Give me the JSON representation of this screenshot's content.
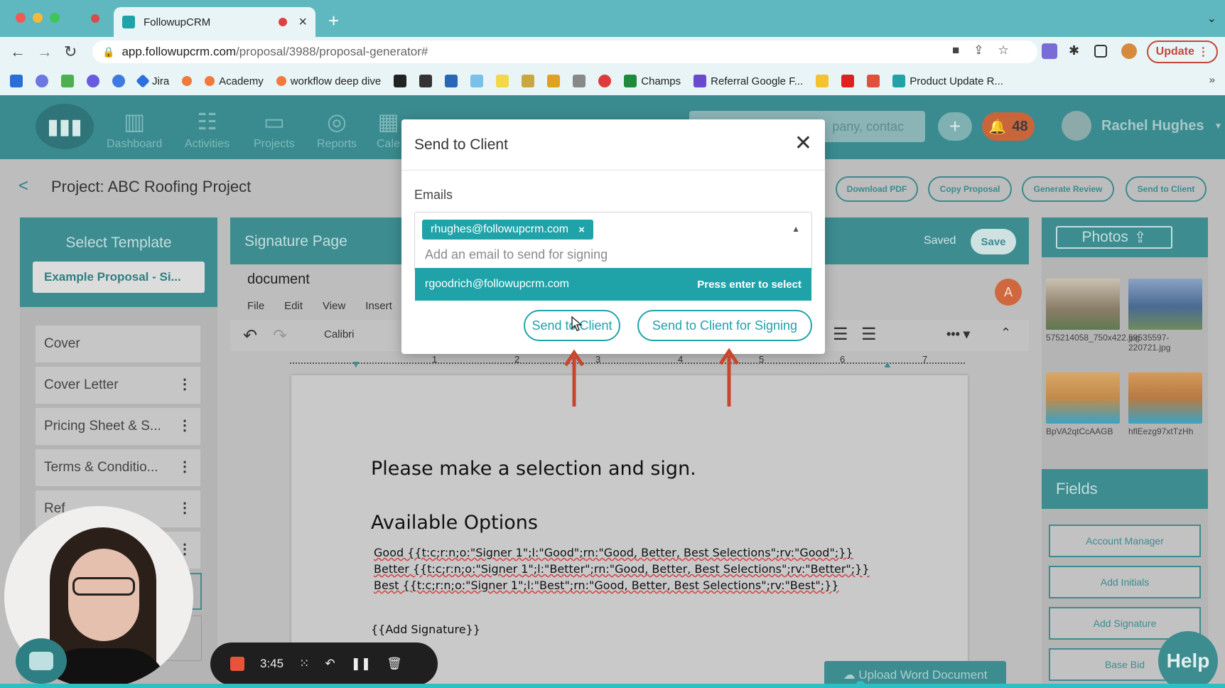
{
  "browser": {
    "tab_title": "FollowupCRM",
    "url_host": "app.followupcrm.com",
    "url_path": "/proposal/3988/proposal-generator#",
    "update_label": "Update",
    "bookmarks": [
      "Jira",
      "Academy",
      "workflow deep dive",
      "Champs",
      "Referral Google F...",
      "Product Update R..."
    ]
  },
  "header": {
    "nav": [
      "Dashboard",
      "Activities",
      "Projects",
      "Reports",
      "Cale"
    ],
    "search_placeholder": "pany, contac",
    "notification_count": "48",
    "user_name": "Rachel Hughes"
  },
  "project": {
    "title": "Project: ABC Roofing Project",
    "buttons": [
      "Download PDF",
      "Copy Proposal",
      "Generate Review",
      "Send to Client"
    ]
  },
  "left_panel": {
    "title": "Select Template",
    "selected_template": "Example Proposal - Si...",
    "sections": [
      "Cover",
      "Cover Letter",
      "Pricing Sheet & S...",
      "Terms & Conditio...",
      "Ref"
    ]
  },
  "editor": {
    "title": "Signature Page",
    "saved_label": "Saved",
    "save_label": "Save",
    "doc_name": "document",
    "menus": [
      "File",
      "Edit",
      "View",
      "Insert"
    ],
    "font": "Calibri",
    "avatar_initial": "A",
    "ruler": [
      "1",
      "2",
      "3",
      "4",
      "5",
      "6",
      "7"
    ],
    "heading": "Please make a selection and sign.",
    "options_heading": "Available Options",
    "option_lines": [
      "Good {{t:c;r:n;o:\"Signer 1\";l:\"Good\";rn:\"Good, Better, Best Selections\";rv:\"Good\";}}",
      "Better {{t:c;r:n;o:\"Signer 1\";l:\"Better\";rn:\"Good, Better, Best Selections\";rv:\"Better\";}}",
      "Best {{t:c;r:n;o:\"Signer 1\";l:\"Best\";rn:\"Good, Better, Best Selections\";rv:\"Best\";}}"
    ],
    "signature_tag": "{{Add Signature}}",
    "upload_label": "Upload Word Document"
  },
  "right_panel": {
    "photos_label": "Photos",
    "photos": [
      {
        "label": "575214058_750x422.jpg",
        "color": "#8a7c66"
      },
      {
        "label": "59535597-220721.jpg",
        "color": "#4a6a92"
      },
      {
        "label": "BpVA2qtCcAAGB",
        "color": "#c28a4a"
      },
      {
        "label": "hflEezg97xtTzHh",
        "color": "#b77a44"
      }
    ],
    "fields_label": "Fields",
    "fields": [
      "Account Manager",
      "Add Initials",
      "Add Signature",
      "Base Bid"
    ],
    "help_label": "Help"
  },
  "recorder": {
    "time": "3:45"
  },
  "modal": {
    "title": "Send to Client",
    "emails_label": "Emails",
    "selected_email": "rhughes@followupcrm.com",
    "input_placeholder": "Add an email to send for signing",
    "suggestion_email": "rgoodrich@followupcrm.com",
    "suggestion_hint": "Press enter to select",
    "send_label": "Send to Client",
    "send_signing_label": "Send to Client for Signing"
  },
  "colors": {
    "teal": "#1fa3a9",
    "header_teal": "#3a8b8f",
    "arrow_red": "#c8462e"
  }
}
